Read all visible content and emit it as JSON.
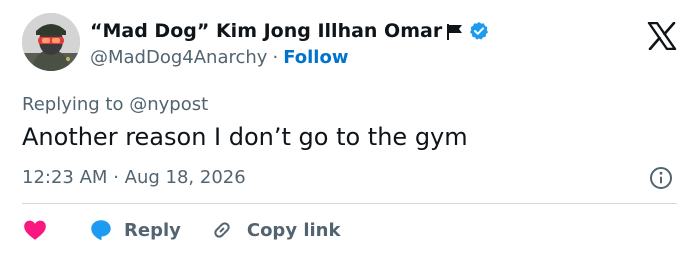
{
  "author": {
    "display_name": "“Mad Dog” Kim Jong Illhan Omar",
    "handle": "@MadDog4Anarchy",
    "separator": "·",
    "follow_label": "Follow",
    "icons": [
      "flag-icon",
      "verified-badge-icon"
    ],
    "verified_color": "#1d9bf0"
  },
  "platform_logo": "x-logo",
  "reply_context": {
    "prefix": "Replying to",
    "mention": "@nypost"
  },
  "tweet": {
    "text": "Another reason I don’t go to the gym",
    "time": "12:23 AM",
    "separator": "·",
    "date": "Aug 18, 2026"
  },
  "actions": {
    "like_icon": "heart-icon",
    "like_color": "#f91880",
    "reply_icon": "reply-bubble-icon",
    "reply_color": "#1d9bf0",
    "reply_label": "Reply",
    "copy_link_icon": "link-icon",
    "copy_link_label": "Copy link"
  }
}
